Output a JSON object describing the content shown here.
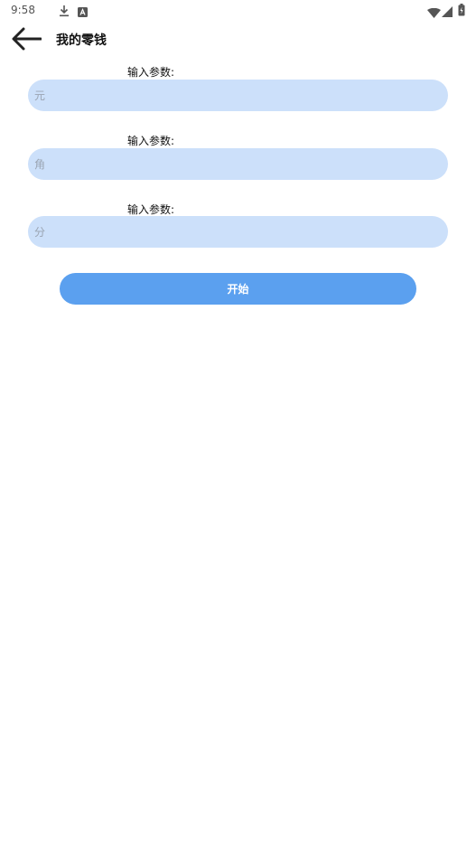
{
  "status_bar": {
    "time": "9:58",
    "icons": [
      "download-icon",
      "a-notification-icon",
      "wifi-icon",
      "cell-signal-icon",
      "battery-icon"
    ]
  },
  "app_bar": {
    "back_icon": "arrow-left-icon",
    "title": "我的零钱"
  },
  "form": {
    "fields": [
      {
        "label": "输入参数:",
        "placeholder": "元",
        "value": ""
      },
      {
        "label": "输入参数:",
        "placeholder": "角",
        "value": ""
      },
      {
        "label": "输入参数:",
        "placeholder": "分",
        "value": ""
      }
    ],
    "start_label": "开始"
  },
  "colors": {
    "input_bg": "#cce0fa",
    "button_bg": "#5ba0ef",
    "button_text": "#ffffff"
  }
}
